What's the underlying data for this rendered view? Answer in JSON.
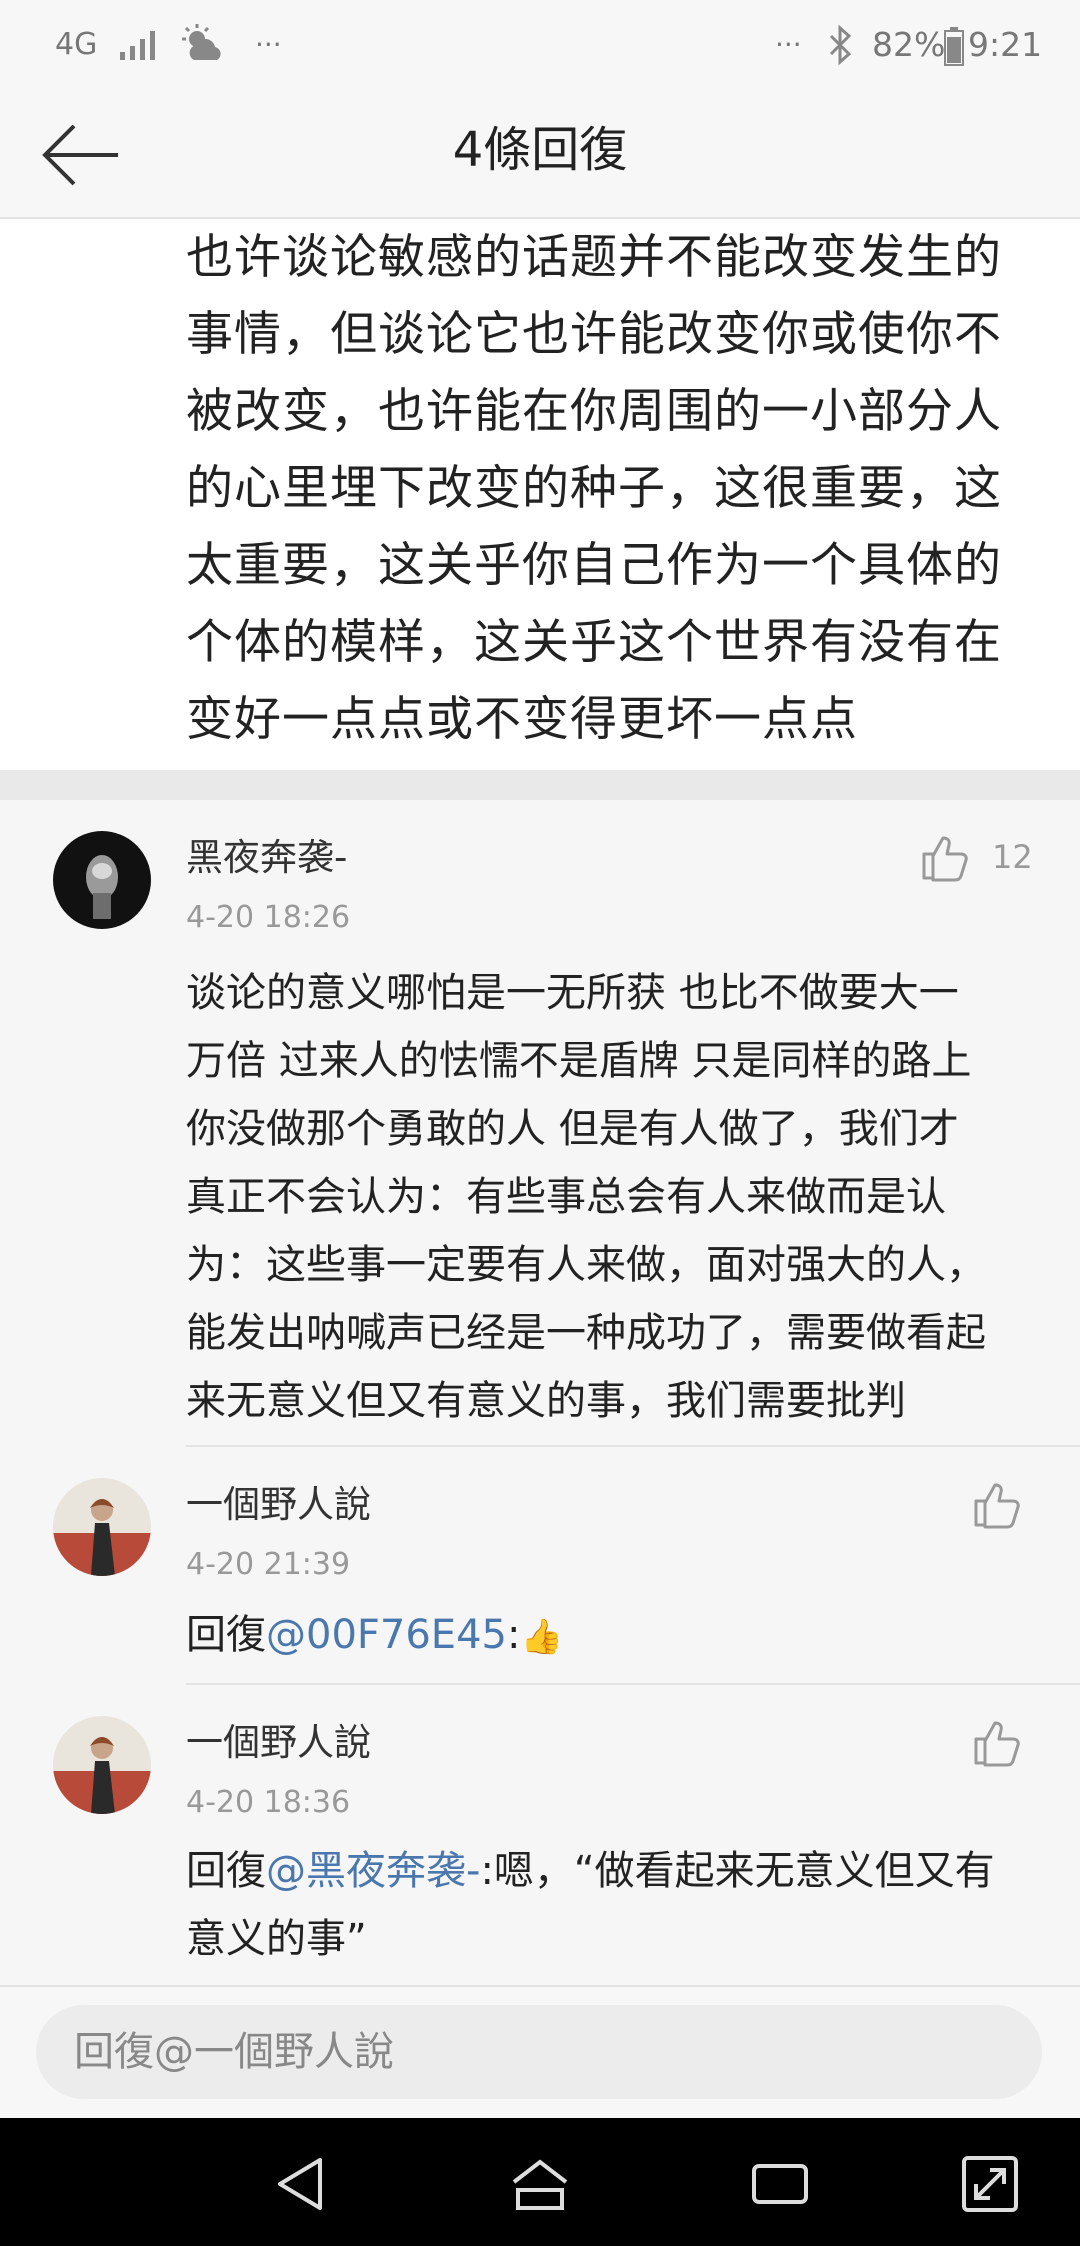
{
  "status_bar": {
    "network": "4G",
    "more_left": "···",
    "more_right": "···",
    "battery": "82%",
    "time": "9:21"
  },
  "header": {
    "title": "4條回復"
  },
  "main_post": {
    "lines": [
      "也许谈论敏感的话题并不能改变发生的",
      "事情，但谈论它也许能改变你或使你不",
      "被改变，也许能在你周围的一小部分人",
      "的心里埋下改变的种子，这很重要，这",
      "太重要，这关乎你自己作为一个具体的",
      "个体的模样，这关乎这个世界有没有在",
      "变好一点点或不变得更坏一点点"
    ]
  },
  "replies": [
    {
      "username": "黑夜奔袭-",
      "time": "4-20 18:26",
      "likes": "12",
      "lines": [
        "谈论的意义哪怕是一无所获 也比不做要大一",
        "万倍 过来人的怯懦不是盾牌  只是同样的路上",
        "你没做那个勇敢的人 但是有人做了，我们才",
        "真正不会认为：有些事总会有人来做而是认",
        "为：这些事一定要有人来做，面对强大的人，",
        "能发出呐喊声已经是一种成功了，需要做看起",
        "来无意义但又有意义的事，我们需要批判"
      ]
    },
    {
      "username": "一個野人說",
      "time": "4-20 21:39",
      "reply_prefix": "回復",
      "mention": "@00F76E45",
      "after_mention": ":",
      "emoji": "👍"
    },
    {
      "username": "一個野人說",
      "time": "4-20 18:36",
      "reply_prefix": "回復",
      "mention": "@黑夜奔袭-",
      "after_mention": ":嗯，“做看起来无意义但又有",
      "line2": "意义的事”"
    }
  ],
  "input": {
    "placeholder": "回復@一個野人說"
  },
  "colors": {
    "mention": "#4a77ad",
    "background": "#f6f6f6"
  }
}
